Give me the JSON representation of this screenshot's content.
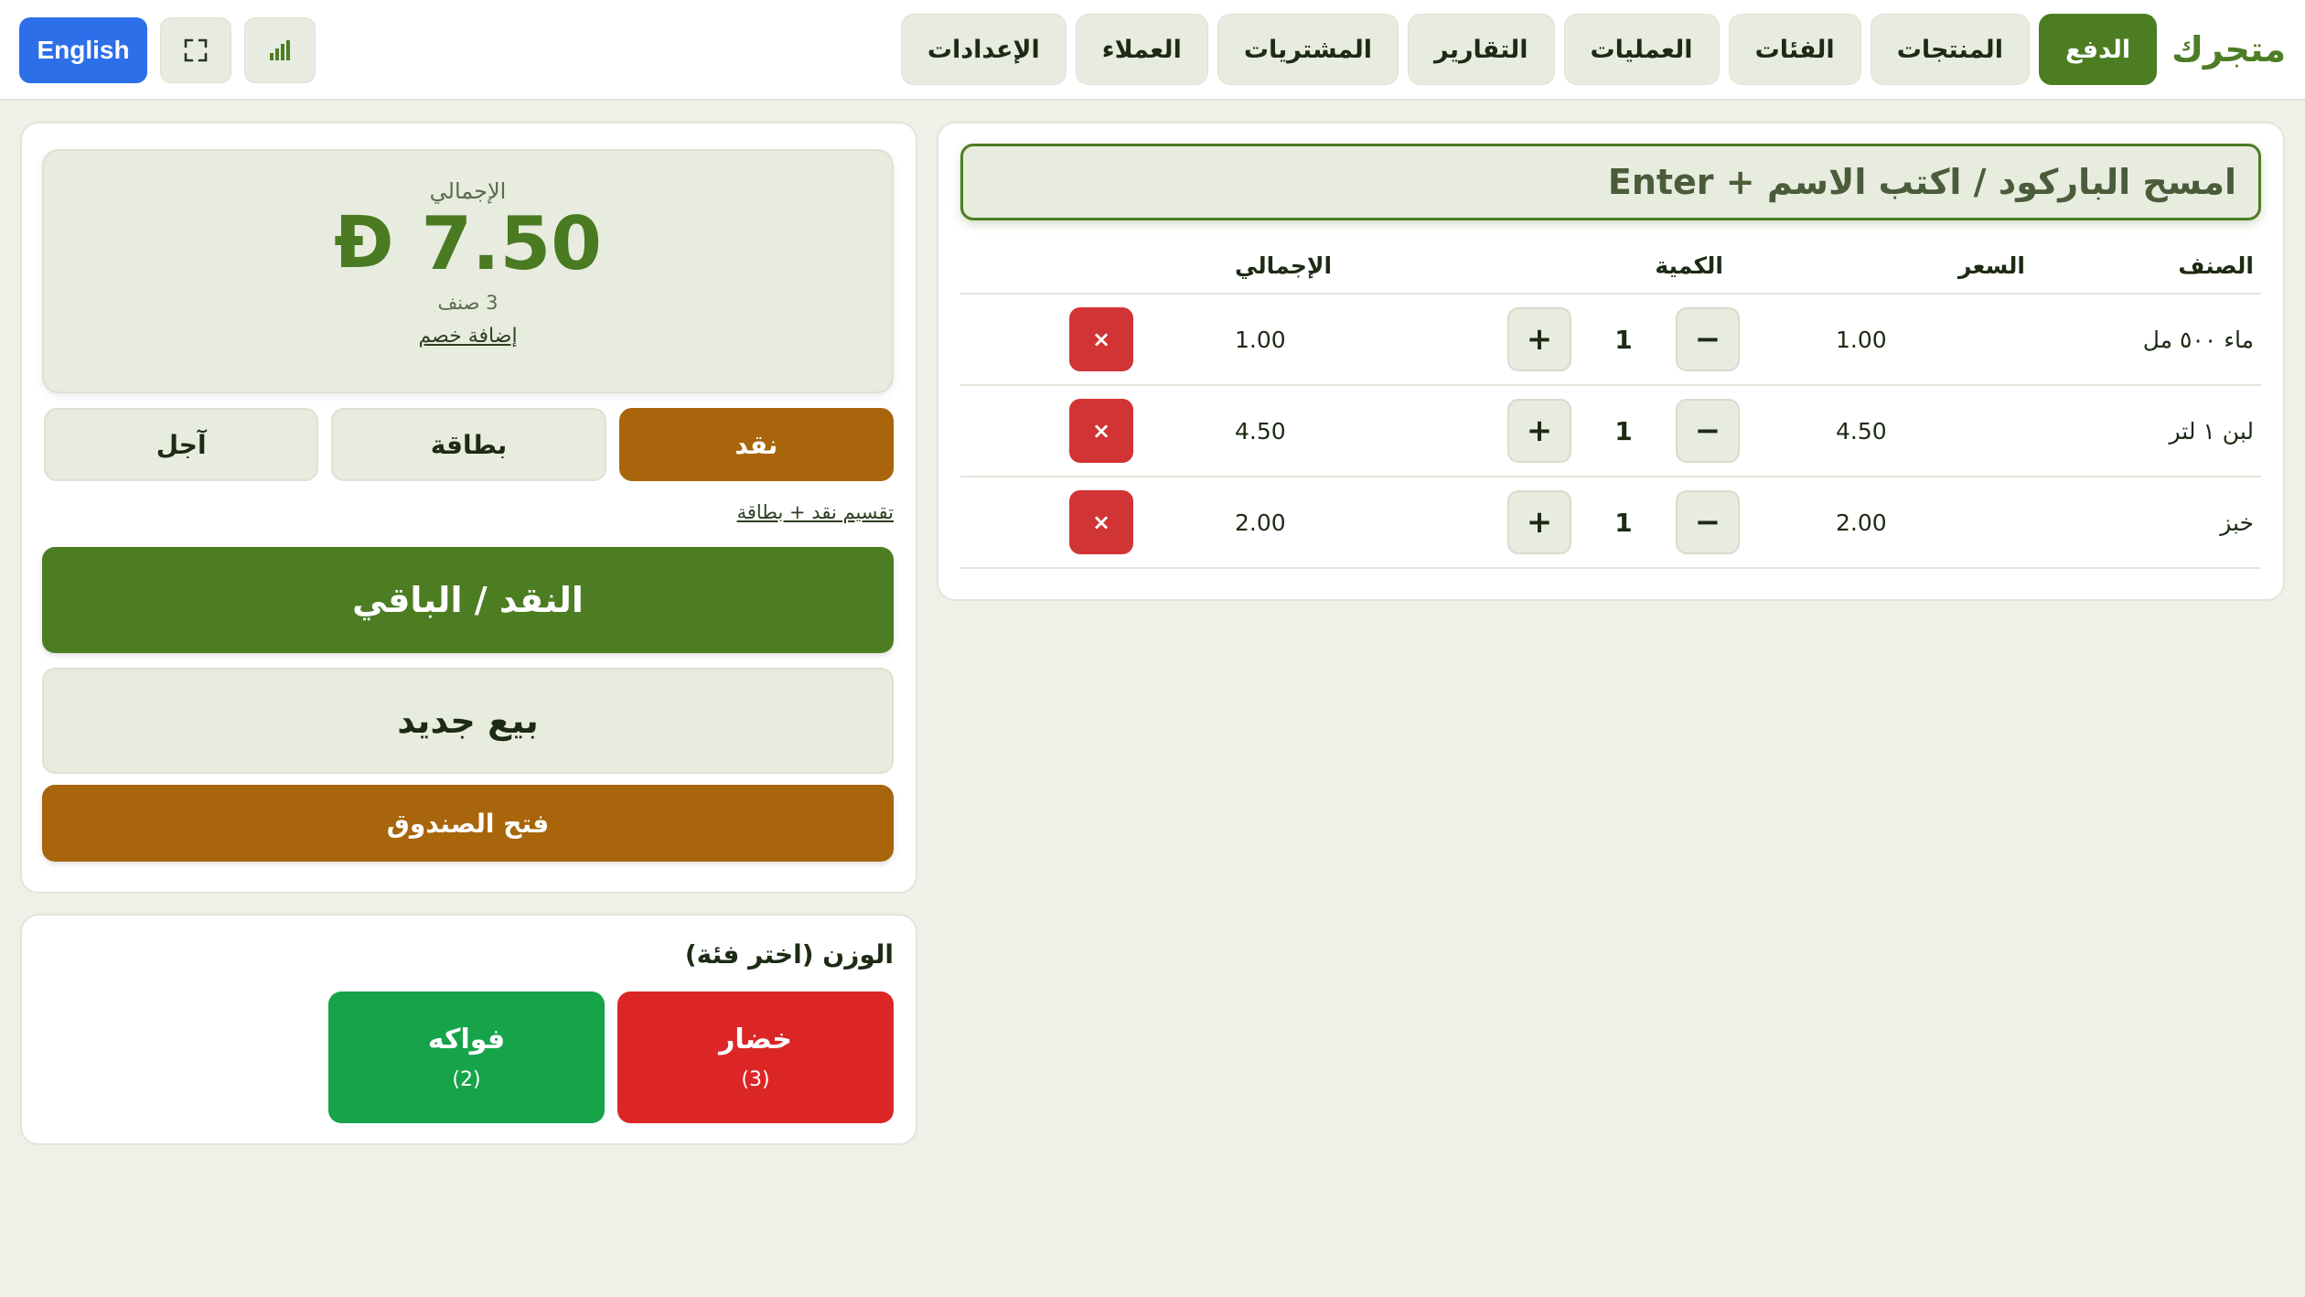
{
  "app": {
    "brand": "متجرك",
    "nav": [
      {
        "label": "الدفع",
        "active": true
      },
      {
        "label": "المنتجات"
      },
      {
        "label": "الفئات"
      },
      {
        "label": "العمليات"
      },
      {
        "label": "التقارير"
      },
      {
        "label": "المشتريات"
      },
      {
        "label": "العملاء"
      },
      {
        "label": "الإعدادات"
      }
    ],
    "language_label": "English",
    "icons": {
      "fullscreen": "fullscreen-icon",
      "stats": "bar-chart-icon"
    }
  },
  "cart": {
    "scan_placeholder": "امسح الباركود / اكتب الاسم + Enter",
    "headers": {
      "item": "الصنف",
      "price": "السعر",
      "qty": "الكمية",
      "total": "الإجمالي"
    },
    "rows": [
      {
        "name": "ماء ٥٠٠ مل",
        "price": "1.00",
        "qty": "1",
        "total": "1.00"
      },
      {
        "name": "لبن ١ لتر",
        "price": "4.50",
        "qty": "1",
        "total": "4.50"
      },
      {
        "name": "خبز",
        "price": "2.00",
        "qty": "1",
        "total": "2.00"
      }
    ],
    "minus_symbol": "−",
    "plus_symbol": "+",
    "delete_symbol": "×"
  },
  "payment": {
    "total_label": "الإجمالي",
    "total_amount": "7.50",
    "currency_symbol": "Ð",
    "item_count": "3 صنف",
    "discount_link": "إضافة خصم",
    "methods": [
      {
        "label": "نقد",
        "active": true
      },
      {
        "label": "بطاقة"
      },
      {
        "label": "آجل"
      }
    ],
    "split_link": "تقسيم نقد + بطاقة",
    "cash_change_label": "النقد / الباقي",
    "new_sale_label": "بيع جديد",
    "open_drawer_label": "فتح الصندوق"
  },
  "weight": {
    "title": "الوزن (اختر فئة)",
    "categories": [
      {
        "name": "خضار",
        "count": "(3)",
        "color": "#dc2626"
      },
      {
        "name": "فواكه",
        "count": "(2)",
        "color": "#16a34a"
      }
    ]
  },
  "colors": {
    "primary": "#4c7d22",
    "accent": "#a8650b",
    "danger": "#d13434",
    "language": "#2d6ee9"
  }
}
